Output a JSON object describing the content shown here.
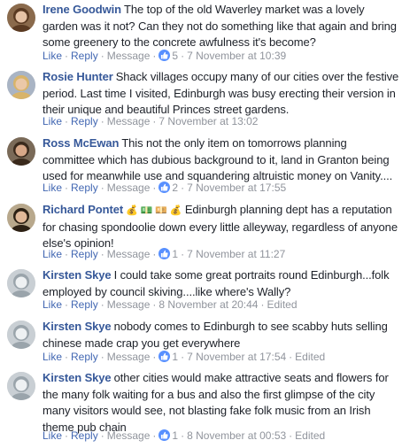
{
  "comments": [
    {
      "author": "Irene Goodwin",
      "avatar": "avatar-photo-woman",
      "text": "The top of the old Waverley market was a lovely garden was it not? Can they not do something like that again and bring some greenery to the concrete awfulness it's become?",
      "like": "Like",
      "reply": "Reply",
      "message": "Message",
      "likes": "5",
      "time": "7 November at 10:39",
      "edited": ""
    },
    {
      "author": "Rosie Hunter",
      "avatar": "avatar-photo-woman-blonde",
      "text": "Shack villages occupy many of our cities over the festive period. Last time I visited, Edinburgh was busy erecting their version in their unique and beautiful Princes street gardens.",
      "like": "Like",
      "reply": "Reply",
      "message": "Message",
      "likes": "",
      "time": "7 November at 13:02",
      "edited": ""
    },
    {
      "author": "Ross McEwan",
      "avatar": "avatar-photo-man",
      "text": "This not the only item on tomorrows planning committee which has dubious background to it, land in Granton being used for meanwhile use and squandering altruistic money on Vanity....",
      "like": "Like",
      "reply": "Reply",
      "message": "Message",
      "likes": "2",
      "time": "7 November at 17:55",
      "edited": ""
    },
    {
      "author": "Richard Pontet",
      "avatar": "avatar-photo-man-smiling",
      "emoji": "💰 💵 💴 💰",
      "text": "Edinburgh planning dept has a reputation for chasing spondoolie down every little alleyway, regardless of anyone else's opinion!",
      "like": "Like",
      "reply": "Reply",
      "message": "Message",
      "likes": "1",
      "time": "7 November at 11:27",
      "edited": ""
    },
    {
      "author": "Kirsten Skye",
      "avatar": "avatar-photo-snowy",
      "text": "I could take some great portraits round Edinburgh...folk employed by council skiving....like where's Wally?",
      "like": "Like",
      "reply": "Reply",
      "message": "Message",
      "likes": "",
      "time": "8 November at 20:44",
      "edited": "Edited"
    },
    {
      "author": "Kirsten Skye",
      "avatar": "avatar-photo-snowy",
      "text": "nobody comes to Edinburgh to see scabby huts selling chinese made crap you get everywhere",
      "like": "Like",
      "reply": "Reply",
      "message": "Message",
      "likes": "1",
      "time": "7 November at 17:54",
      "edited": "Edited"
    },
    {
      "author": "Kirsten Skye",
      "avatar": "avatar-photo-snowy",
      "text": "other cities would make attractive seats and flowers for the many folk waiting for a bus and also the first glimpse of the city many visitors would see, not blasting fake folk music from an Irish theme pub chain",
      "like": "Like",
      "reply": "Reply",
      "message": "Message",
      "likes": "1",
      "time": "8 November at 00:53",
      "edited": "Edited"
    }
  ],
  "colors": {
    "link": "#365899",
    "action": "#4267b2",
    "meta": "#90949c",
    "like_badge": "#5890ff"
  }
}
